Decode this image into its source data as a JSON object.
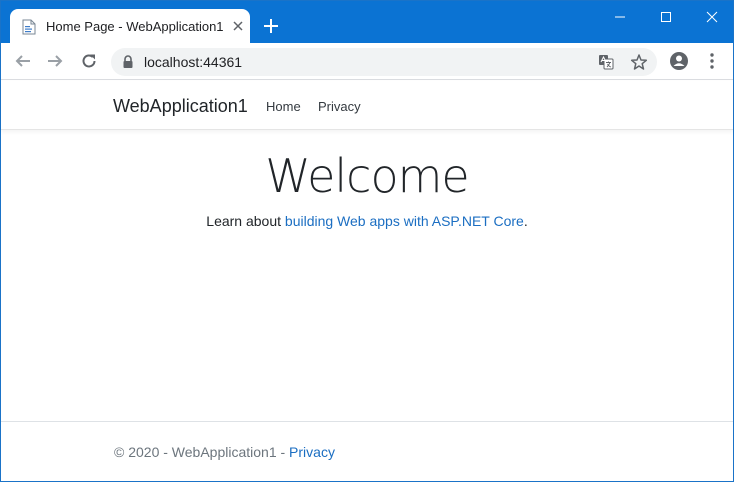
{
  "browser": {
    "tab_title": "Home Page - WebApplication1",
    "url": "localhost:44361"
  },
  "navbar": {
    "brand": "WebApplication1",
    "items": [
      {
        "label": "Home"
      },
      {
        "label": "Privacy"
      }
    ]
  },
  "main": {
    "heading": "Welcome",
    "learn_prefix": "Learn about ",
    "learn_link": "building Web apps with ASP.NET Core",
    "learn_suffix": "."
  },
  "footer": {
    "copyright": "© 2020 - WebApplication1 - ",
    "privacy_link": "Privacy"
  },
  "colors": {
    "titlebar": "#0b73d3",
    "link": "#1b6ec2"
  },
  "icons": [
    "page-favicon-icon",
    "close-icon",
    "plus-icon",
    "minimize-icon",
    "maximize-icon",
    "back-arrow-icon",
    "forward-arrow-icon",
    "reload-icon",
    "lock-icon",
    "translate-icon",
    "star-icon",
    "profile-icon",
    "kebab-menu-icon"
  ]
}
